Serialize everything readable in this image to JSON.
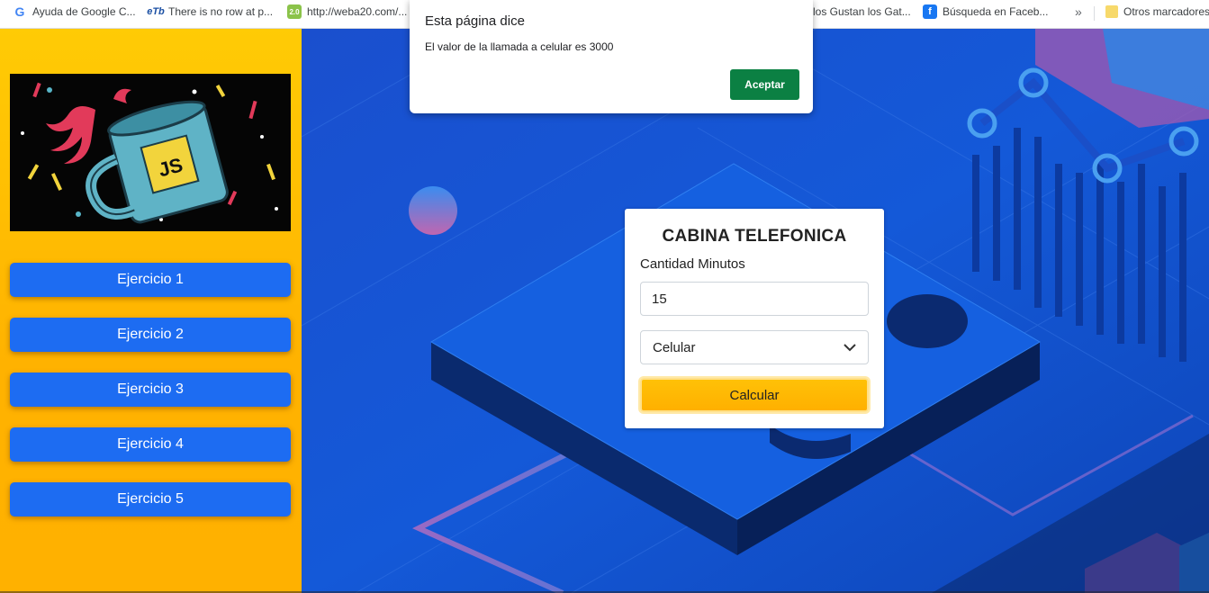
{
  "bookmarks": [
    {
      "label": "Ayuda de Google C...",
      "icon": "google-icon"
    },
    {
      "label": "There is no row at p...",
      "icon": "etb-icon"
    },
    {
      "label": "http://weba20.com/...",
      "icon": "weba-icon"
    },
    {
      "label": "los Gustan los Gat...",
      "icon": "none"
    },
    {
      "label": "Búsqueda en Faceb...",
      "icon": "facebook-icon"
    },
    {
      "label": "Otros marcadores",
      "icon": "folder-icon"
    }
  ],
  "bookmarks_more": "»",
  "sidebar": {
    "logo_text": "JS",
    "items": [
      {
        "label": "Ejercicio 1"
      },
      {
        "label": "Ejercicio 2"
      },
      {
        "label": "Ejercicio 3"
      },
      {
        "label": "Ejercicio 4"
      },
      {
        "label": "Ejercicio 5"
      }
    ]
  },
  "card": {
    "title": "CABINA TELEFONICA",
    "minutes_label": "Cantidad Minutos",
    "minutes_value": "15",
    "type_selected": "Celular",
    "calc_button": "Calcular"
  },
  "dialog": {
    "title": "Esta página dice",
    "message": "El valor de la llamada a celular es 3000",
    "ok_button": "Aceptar"
  },
  "colors": {
    "sidebar": "#ffb800",
    "menu_button": "#1d6cf2",
    "background": "#1557d6",
    "accept_button": "#0b8043",
    "calc_button": "#ffc107"
  }
}
